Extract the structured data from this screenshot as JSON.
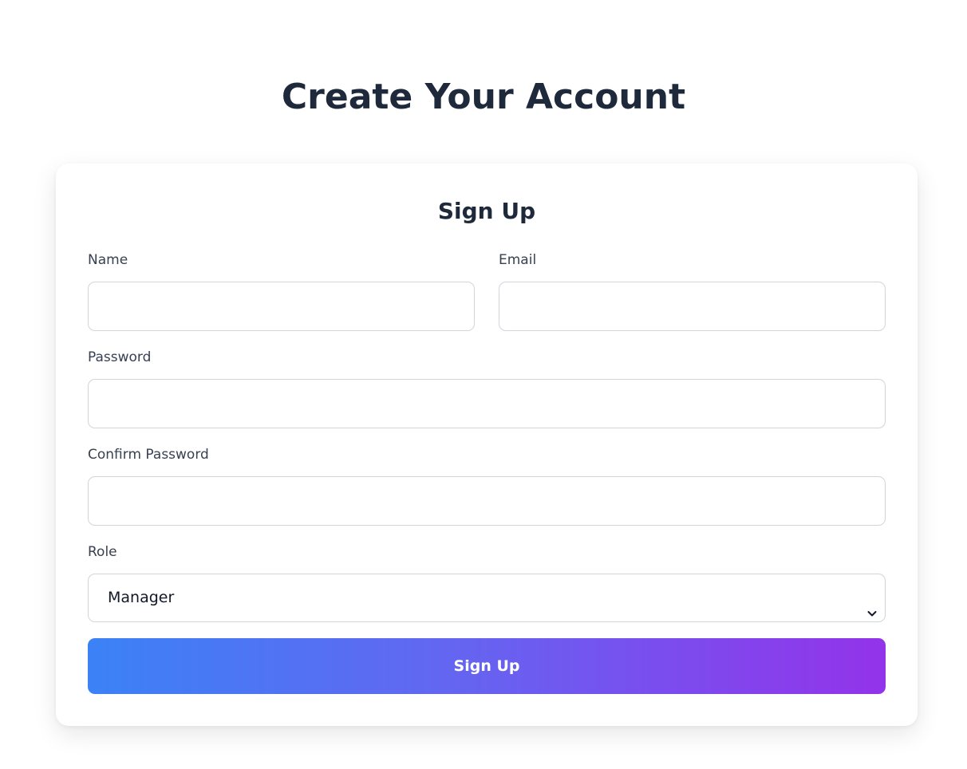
{
  "page": {
    "title": "Create Your Account"
  },
  "form": {
    "title": "Sign Up",
    "fields": {
      "name": {
        "label": "Name",
        "value": "",
        "placeholder": ""
      },
      "email": {
        "label": "Email",
        "value": "",
        "placeholder": ""
      },
      "password": {
        "label": "Password",
        "value": "",
        "placeholder": ""
      },
      "confirm_password": {
        "label": "Confirm Password",
        "value": "",
        "placeholder": ""
      },
      "role": {
        "label": "Role",
        "selected": "Manager",
        "icon": "chevron-down-icon"
      }
    },
    "submit_label": "Sign Up"
  },
  "colors": {
    "heading": "#1e293b",
    "button_gradient_start": "#3b82f6",
    "button_gradient_end": "#9333ea",
    "input_border": "#d1d5db"
  }
}
